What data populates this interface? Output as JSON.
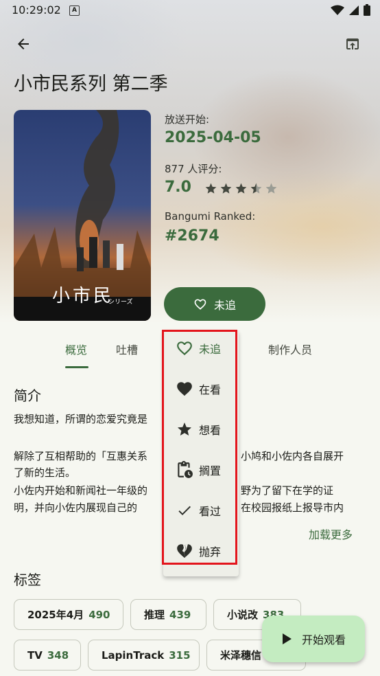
{
  "status": {
    "time": "10:29:02",
    "a_badge": "A"
  },
  "anime": {
    "title": "小市民系列 第二季"
  },
  "poster": {
    "logo": "小市民",
    "subtitle": "シリーズ"
  },
  "info": {
    "air_label": "放送开始:",
    "air_date": "2025-04-05",
    "rating_label": "877 人评分:",
    "score": "7.0",
    "stars_value": 3.5,
    "rank_label": "Bangumi Ranked:",
    "rank": "#2674"
  },
  "follow_button": {
    "label": "未追"
  },
  "tabs": [
    {
      "label": "概览",
      "active": true
    },
    {
      "label": "吐槽"
    },
    {
      "label": "制作人员"
    }
  ],
  "intro": {
    "title": "简介",
    "line1": "我想知道，所谓的恋爱究竟是",
    "line2": "解除了互相帮助的「互惠关系",
    "line2b": "小鸠和小佐内各自展开",
    "line3": "了新的生活。",
    "line4": "小佐内开始和新闻社一年级的",
    "line4b": "野为了留下在学的证",
    "line5": "明，并向小佐内展现自己的",
    "line5b": "在校园报纸上报导市内",
    "load_more": "加载更多"
  },
  "tags": {
    "title": "标签",
    "items": [
      {
        "name": "2025年4月",
        "count": "490"
      },
      {
        "name": "推理",
        "count": "439"
      },
      {
        "name": "小说改",
        "count": "383"
      },
      {
        "name": "TV",
        "count": "348"
      },
      {
        "name": "LapinTrack",
        "count": "315"
      },
      {
        "name": "米泽穗信",
        "count": ""
      }
    ]
  },
  "menu": {
    "items": [
      {
        "label": "未追",
        "icon": "heart-outline-icon",
        "selected": true
      },
      {
        "label": "在看",
        "icon": "heart-filled-icon"
      },
      {
        "label": "想看",
        "icon": "star-icon"
      },
      {
        "label": "搁置",
        "icon": "clipboard-clock-icon"
      },
      {
        "label": "看过",
        "icon": "check-icon"
      },
      {
        "label": "抛弃",
        "icon": "heart-broken-icon"
      }
    ]
  },
  "fab": {
    "label": "开始观看"
  },
  "colors": {
    "accent": "#3b6b3d",
    "fab": "#c4ecc1",
    "highlight": "#e3141b"
  }
}
